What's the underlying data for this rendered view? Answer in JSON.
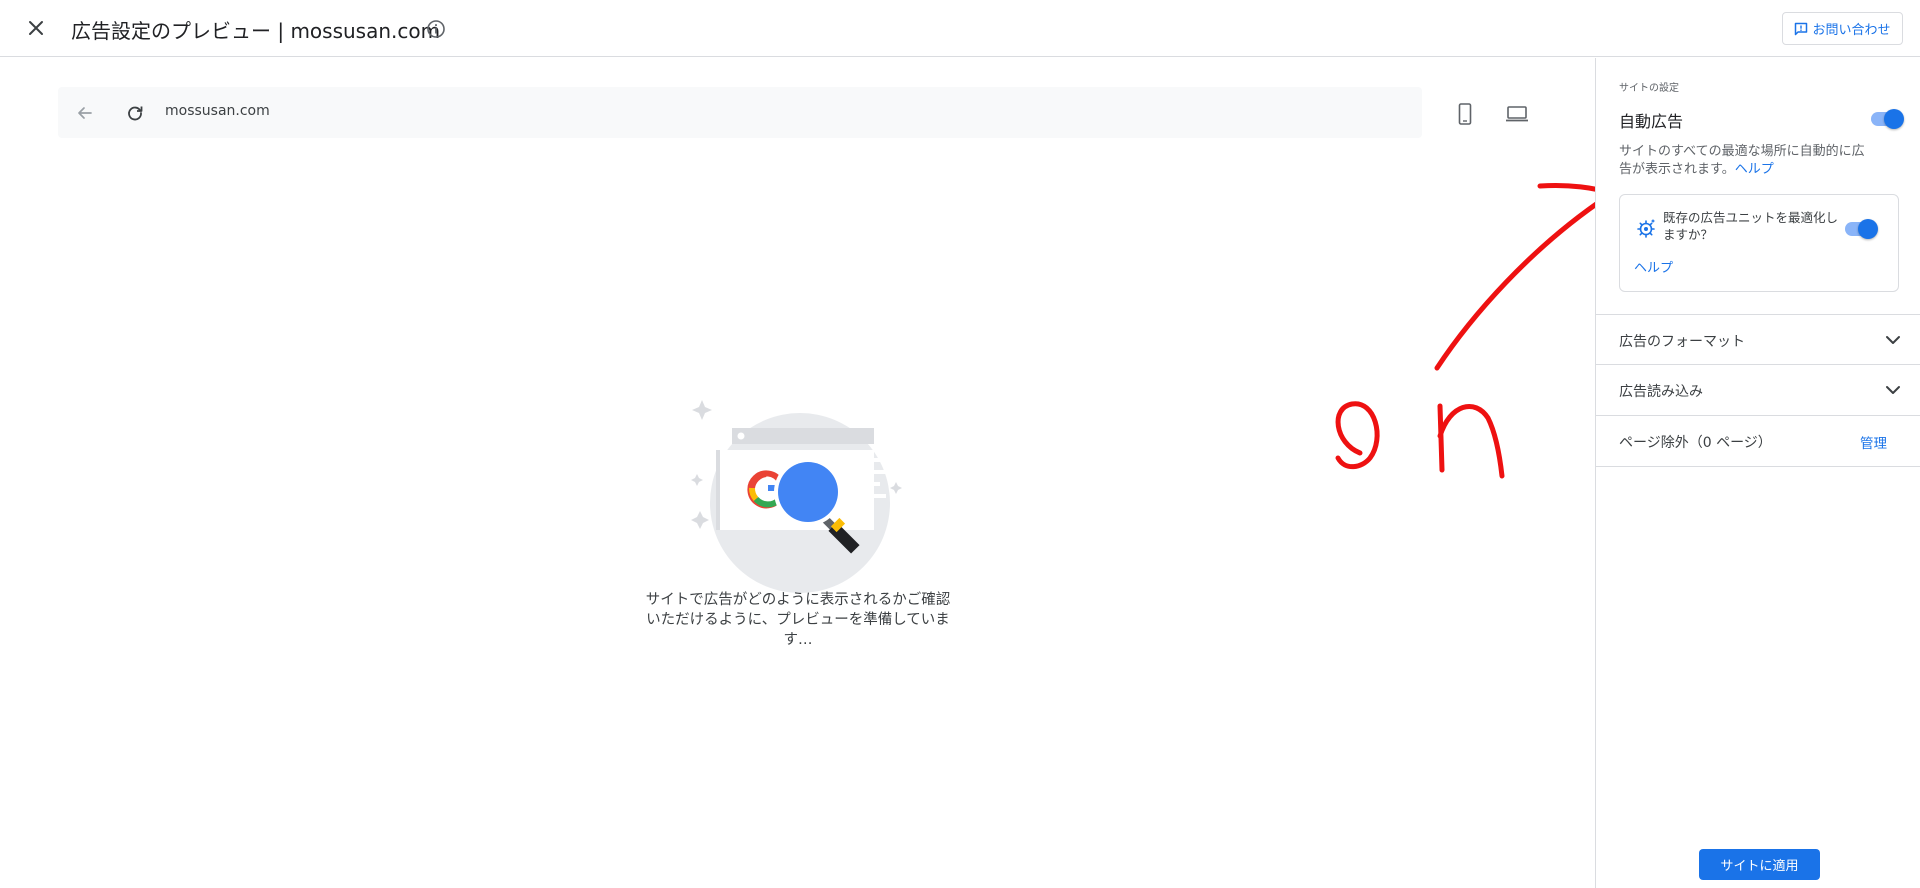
{
  "header": {
    "title": "広告設定のプレビュー | mossusan.com",
    "contact_label": "お問い合わせ"
  },
  "preview": {
    "address": "mossusan.com",
    "loading_message": "サイトで広告がどのように表示されるかご確認いただけるように、プレビューを準備しています…"
  },
  "annotation": {
    "handwritten_text": "on",
    "color": "#ee1111"
  },
  "side_panel": {
    "section_label": "サイトの設定",
    "auto_ads": {
      "title": "自動広告",
      "enabled": true,
      "description": "サイトのすべての最適な場所に自動的に広告が表示されます。",
      "help": "ヘルプ"
    },
    "optimize": {
      "text": "既存の広告ユニットを最適化しますか？",
      "enabled": true,
      "help": "ヘルプ"
    },
    "rows": {
      "ad_formats": "広告のフォーマット",
      "ad_loading": "広告読み込み",
      "page_exclusion": "ページ除外（0 ページ）",
      "manage": "管理"
    },
    "apply_label": "サイトに適用"
  },
  "colors": {
    "accent": "#1a73e8",
    "toggle_track": "#8ab4f8",
    "divider": "#dadce0"
  },
  "icons": [
    "close-icon",
    "info-icon",
    "feedback-icon",
    "back-arrow-icon",
    "reload-icon",
    "mobile-device-icon",
    "desktop-device-icon",
    "optimize-gear-icon",
    "chevron-down-icon"
  ]
}
